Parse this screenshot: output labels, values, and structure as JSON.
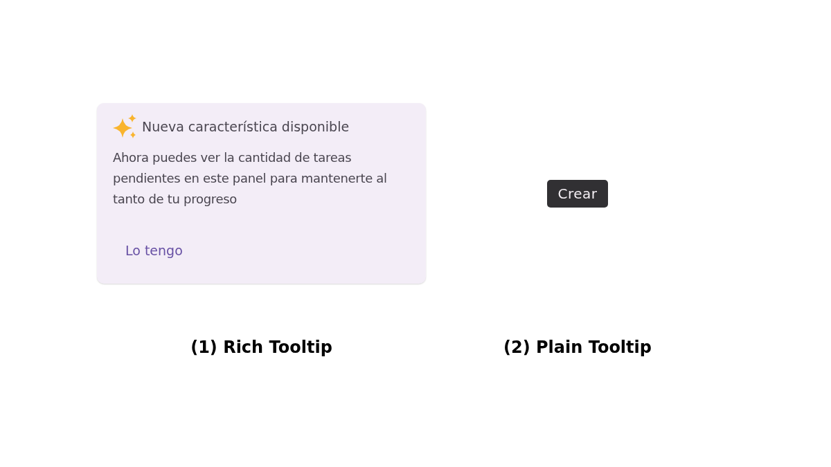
{
  "examples": [
    {
      "kind": "rich",
      "title": "Nueva característica disponible",
      "body": "Ahora puedes ver la cantidad de tareas pendientes en este panel para mantenerte al tanto de tu progreso",
      "action": "Lo tengo",
      "caption": "(1) Rich Tooltip"
    },
    {
      "kind": "plain",
      "text": "Crear",
      "caption": "(2) Plain Tooltip"
    }
  ]
}
